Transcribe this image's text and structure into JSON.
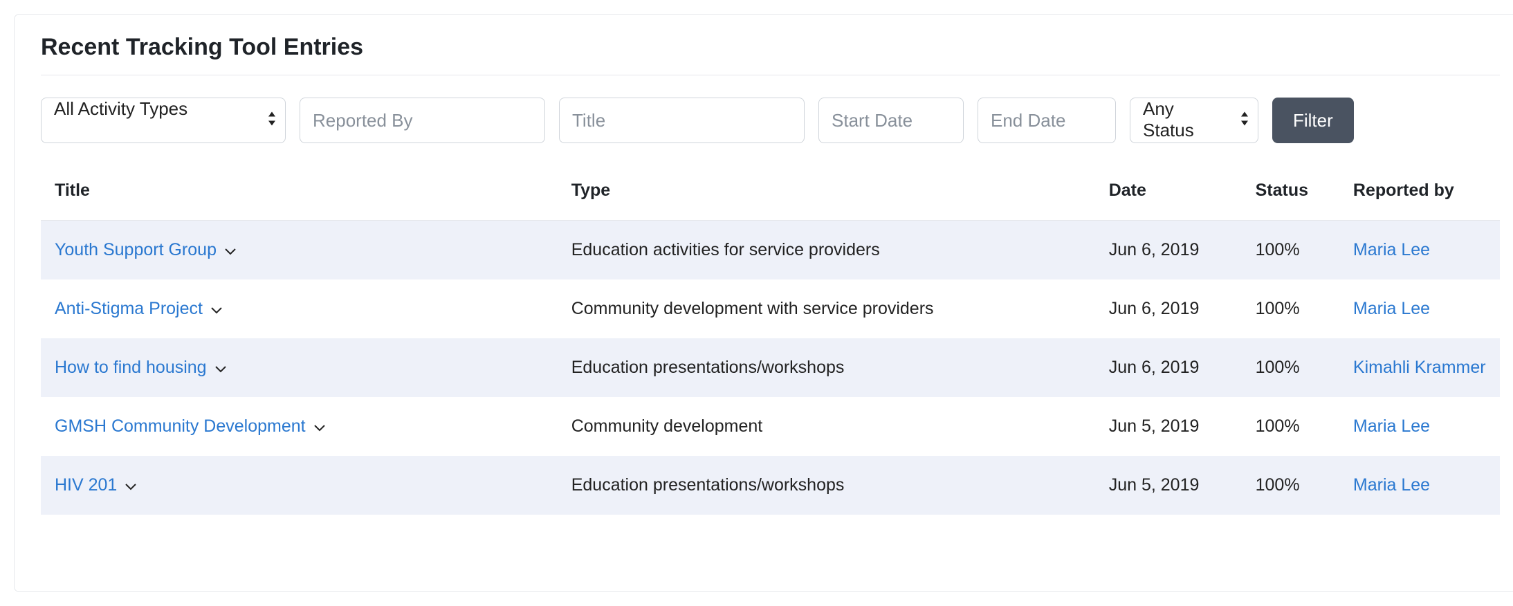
{
  "header": {
    "title": "Recent Tracking Tool Entries"
  },
  "filters": {
    "activity_type_label": "All Activity Types",
    "reported_by_placeholder": "Reported By",
    "title_placeholder": "Title",
    "start_date_placeholder": "Start Date",
    "end_date_placeholder": "End Date",
    "status_label": "Any Status",
    "filter_button_label": "Filter"
  },
  "table": {
    "columns": {
      "title": "Title",
      "type": "Type",
      "date": "Date",
      "status": "Status",
      "reported_by": "Reported by"
    },
    "rows": [
      {
        "title": "Youth Support Group",
        "type": "Education activities for service providers",
        "date": "Jun 6, 2019",
        "status": "100%",
        "reported_by": "Maria Lee"
      },
      {
        "title": "Anti-Stigma Project",
        "type": "Community development with service providers",
        "date": "Jun 6, 2019",
        "status": "100%",
        "reported_by": "Maria Lee"
      },
      {
        "title": "How to find housing",
        "type": "Education presentations/workshops",
        "date": "Jun 6, 2019",
        "status": "100%",
        "reported_by": "Kimahli Krammer"
      },
      {
        "title": "GMSH Community Development",
        "type": "Community development",
        "date": "Jun 5, 2019",
        "status": "100%",
        "reported_by": "Maria Lee"
      },
      {
        "title": "HIV 201",
        "type": "Education presentations/workshops",
        "date": "Jun 5, 2019",
        "status": "100%",
        "reported_by": "Maria Lee"
      }
    ]
  }
}
